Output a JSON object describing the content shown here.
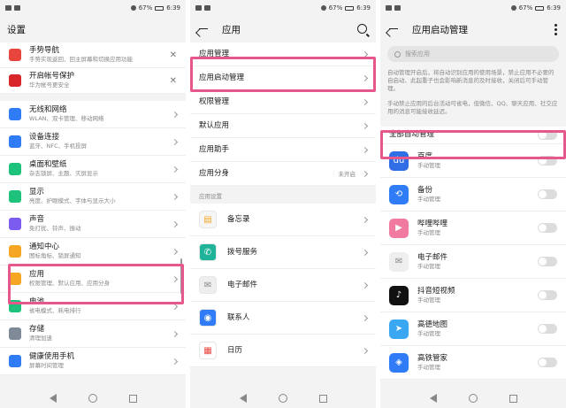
{
  "status": {
    "time": "6:39",
    "battery": "67%"
  },
  "panel1": {
    "title": "设置",
    "top_items": [
      {
        "title": "手势导航",
        "sub": "手势实现返回、回主屏幕和切换应用功能",
        "color": "#e8453c"
      },
      {
        "title": "开启帐号保护",
        "sub": "华为帐号更安全",
        "color": "#d9262b"
      }
    ],
    "items": [
      {
        "title": "无线和网络",
        "sub": "WLAN、双卡管理、移动网络",
        "color": "#2f7cf6"
      },
      {
        "title": "设备连接",
        "sub": "蓝牙、NFC、手机投屏",
        "color": "#2f7cf6"
      },
      {
        "title": "桌面和壁纸",
        "sub": "杂志锁屏、主题、灭屏显示",
        "color": "#1ec27a"
      },
      {
        "title": "显示",
        "sub": "亮度、护眼模式、字体与显示大小",
        "color": "#1ec27a"
      },
      {
        "title": "声音",
        "sub": "免打扰、铃声、振动",
        "color": "#7c5cf0"
      },
      {
        "title": "通知中心",
        "sub": "图标角标、锁屏通知",
        "color": "#f5a623"
      },
      {
        "title": "应用",
        "sub": "权限管理、默认应用、应用分身",
        "color": "#f5a623"
      },
      {
        "title": "电池",
        "sub": "省电模式、耗电排行",
        "color": "#1ec27a"
      },
      {
        "title": "存储",
        "sub": "清理加速",
        "color": "#7f8a99"
      },
      {
        "title": "健康使用手机",
        "sub": "屏幕时间管理",
        "color": "#2f7cf6"
      }
    ]
  },
  "panel2": {
    "title": "应用",
    "menu": [
      {
        "title": "应用管理",
        "side": ""
      },
      {
        "title": "应用启动管理",
        "side": ""
      },
      {
        "title": "权限管理",
        "side": ""
      },
      {
        "title": "默认应用",
        "side": ""
      },
      {
        "title": "应用助手",
        "side": ""
      },
      {
        "title": "应用分身",
        "side": "未开启"
      }
    ],
    "section_label": "应用设置",
    "apps": [
      {
        "title": "备忘录",
        "color": "#f6f6f6",
        "glyph": "▤",
        "glyph_color": "#f5a623"
      },
      {
        "title": "拨号服务",
        "color": "#1fb39a",
        "glyph": "✆",
        "glyph_color": "#ffffff"
      },
      {
        "title": "电子邮件",
        "color": "#eeeeee",
        "glyph": "✉",
        "glyph_color": "#888888"
      },
      {
        "title": "联系人",
        "color": "#2f7cf6",
        "glyph": "◉",
        "glyph_color": "#ffffff"
      },
      {
        "title": "日历",
        "color": "#ffffff",
        "glyph": "▦",
        "glyph_color": "#e8453c"
      }
    ]
  },
  "panel3": {
    "title": "应用启动管理",
    "search_placeholder": "搜索应用",
    "desc1": "自动管理开启后，将自动识别应用的使用场景，禁止应用不必要的自启动、此起重子也会影响新消息的及时接收，关闭后可手动管理。",
    "desc2": "手动禁止应用的后台活动可省电，但微信、QQ、聊天应用、社交应用的消息可能接收延迟。",
    "all_label": "全部自动管理",
    "apps": [
      {
        "name": "百度",
        "status": "手动管理",
        "color": "#2f6ee5",
        "glyph": "du"
      },
      {
        "name": "备份",
        "status": "手动管理",
        "color": "#2f7cf6",
        "glyph": "⟲"
      },
      {
        "name": "哔哩哔哩",
        "status": "手动管理",
        "color": "#f07aa0",
        "glyph": "▶"
      },
      {
        "name": "电子邮件",
        "status": "手动管理",
        "color": "#eeeeee",
        "glyph": "✉"
      },
      {
        "name": "抖音短视频",
        "status": "手动管理",
        "color": "#111111",
        "glyph": "♪"
      },
      {
        "name": "高德地图",
        "status": "手动管理",
        "color": "#3aa7f2",
        "glyph": "➤"
      },
      {
        "name": "高铁管家",
        "status": "手动管理",
        "color": "#2f7cf6",
        "glyph": "◈"
      }
    ]
  },
  "highlight_color": "#e6578c"
}
